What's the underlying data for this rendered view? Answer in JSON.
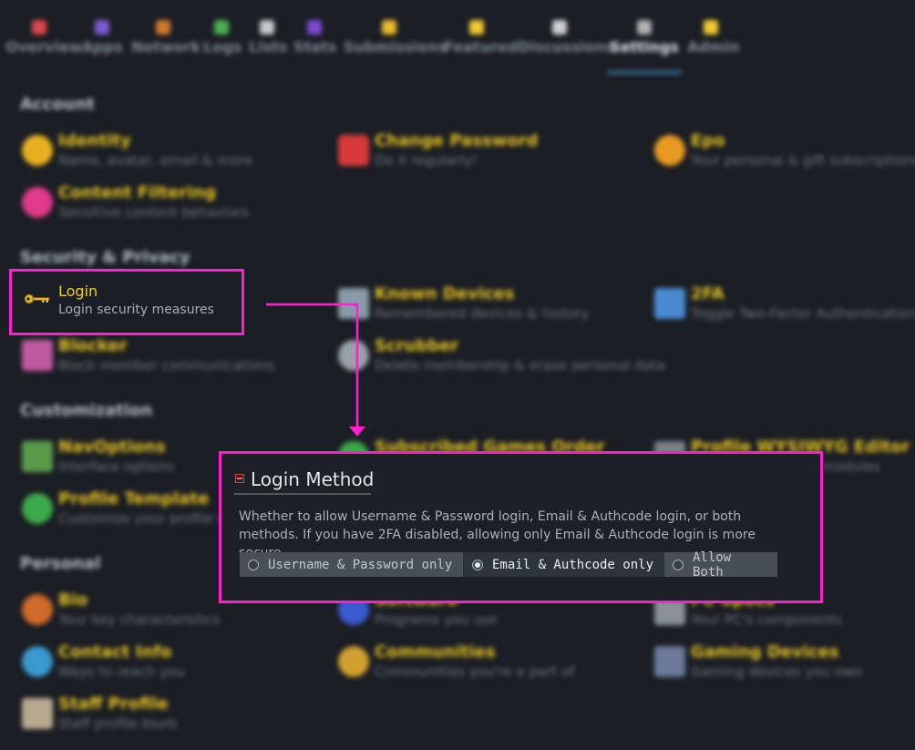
{
  "nav": {
    "items": [
      {
        "label": "Overview",
        "color": "#d94a4a"
      },
      {
        "label": "Apps",
        "color": "#7c5bd0"
      },
      {
        "label": "Network",
        "color": "#d07a2a"
      },
      {
        "label": "Logs",
        "color": "#4caf50"
      },
      {
        "label": "Lists",
        "color": "#c8c8c8"
      },
      {
        "label": "Stats",
        "color": "#7a4ad0"
      },
      {
        "label": "Submissions",
        "color": "#e8b830"
      },
      {
        "label": "Featured",
        "color": "#f0c830"
      },
      {
        "label": "Discussions",
        "color": "#d0d0d0"
      },
      {
        "label": "Settings",
        "color": "#b0b0b0"
      },
      {
        "label": "Admin",
        "color": "#f0c830"
      }
    ],
    "active": "Settings"
  },
  "sections": {
    "account": "Account",
    "security": "Security & Privacy",
    "customization": "Customization",
    "personal": "Personal"
  },
  "entries": {
    "identity": {
      "title": "Identity",
      "desc": "Name, avatar, email & more",
      "icon": "moon-icon"
    },
    "change_password": {
      "title": "Change Password",
      "desc": "Do it regularly!",
      "icon": "lock-icon"
    },
    "epo": {
      "title": "Epo",
      "desc": "Your personal & gift subscriptions",
      "icon": "gift-icon"
    },
    "content_filtering": {
      "title": "Content Filtering",
      "desc": "Sensitive content behaviors",
      "icon": "heart-icon"
    },
    "known_devices": {
      "title": "Known Devices",
      "desc": "Remembered devices & history",
      "icon": "devices-icon"
    },
    "twofa": {
      "title": "2FA",
      "desc": "Toggle Two-Factor Authentication",
      "icon": "2fa-icon"
    },
    "blocker": {
      "title": "Blocker",
      "desc": "Block member communications",
      "icon": "blocker-icon"
    },
    "scrubber": {
      "title": "Scrubber",
      "desc": "Delete membership & erase personal data",
      "icon": "gear-icon"
    },
    "navoptions": {
      "title": "NavOptions",
      "desc": "Interface options",
      "icon": "nav-icon"
    },
    "subscribed_games": {
      "title": "Subscribed Games Order",
      "desc": "",
      "icon": "games-icon"
    },
    "profile_wysiwyg": {
      "title": "Profile WYSIWYG Editor",
      "desc": "modules",
      "icon": "editor-icon"
    },
    "profile_template": {
      "title": "Profile Template",
      "desc": "Customize your profile with",
      "icon": "eye-icon"
    },
    "bio": {
      "title": "Bio",
      "desc": "Your key characteristics",
      "icon": "person-icon"
    },
    "software": {
      "title": "Software",
      "desc": "Programs you use",
      "icon": "software-icon"
    },
    "pc_specs": {
      "title": "PC Specs",
      "desc": "Your PC's components",
      "icon": "pc-icon"
    },
    "contact_info": {
      "title": "Contact Info",
      "desc": "Ways to reach you",
      "icon": "contact-icon"
    },
    "communities": {
      "title": "Communities",
      "desc": "Communities you're a part of",
      "icon": "communities-icon"
    },
    "gaming_devices": {
      "title": "Gaming Devices",
      "desc": "Gaming devices you own",
      "icon": "gamepad-icon"
    },
    "staff_profile": {
      "title": "Staff Profile",
      "desc": "Staff profile blurb",
      "icon": "building-icon"
    }
  },
  "login": {
    "title": "Login",
    "desc": "Login security measures"
  },
  "dialog": {
    "title": "Login Method",
    "description": "Whether to allow Username & Password login, Email & Authcode login, or both methods. If you have 2FA disabled, allowing only Email & Authcode login is more secure.",
    "options": [
      "Username & Password only",
      "Email & Authcode only",
      "Allow Both"
    ],
    "selected": "Email & Authcode only"
  },
  "colors": {
    "highlight": "#ff1fd0",
    "title_yellow": "#f0cf2a",
    "background": "#1b1e24"
  }
}
